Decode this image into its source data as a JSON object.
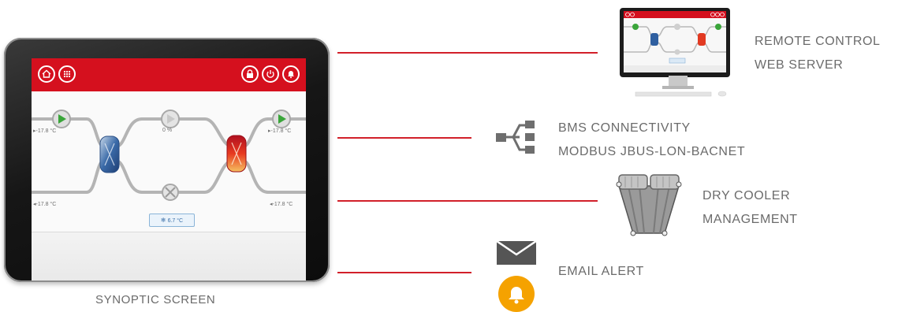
{
  "synoptic": {
    "caption": "SYNOPTIC SCREEN",
    "temp_in_top": "▸-17.8 °C",
    "temp_out_top": "▸-17.8 °C",
    "percent": "0 %",
    "temp_in_bottom": "◂-17.8 °C",
    "temp_out_bottom": "◂-17.8 °C",
    "setpoint": "6.7 °C"
  },
  "features": {
    "remote": {
      "line1": "REMOTE CONTROL",
      "line2": "WEB SERVER"
    },
    "bms": {
      "line1": "BMS CONNECTIVITY",
      "line2": "MODBUS JBUS-LON-BACNET"
    },
    "drycooler": {
      "line1": "DRY COOLER",
      "line2": "MANAGEMENT"
    },
    "email": {
      "line1": "EMAIL ALERT"
    }
  },
  "colors": {
    "accent": "#d2202a",
    "alert": "#f5a200",
    "text": "#6b6b6b"
  },
  "icons": [
    "monitor-icon",
    "network-share-icon",
    "dry-cooler-icon",
    "envelope-icon",
    "bell-icon"
  ]
}
